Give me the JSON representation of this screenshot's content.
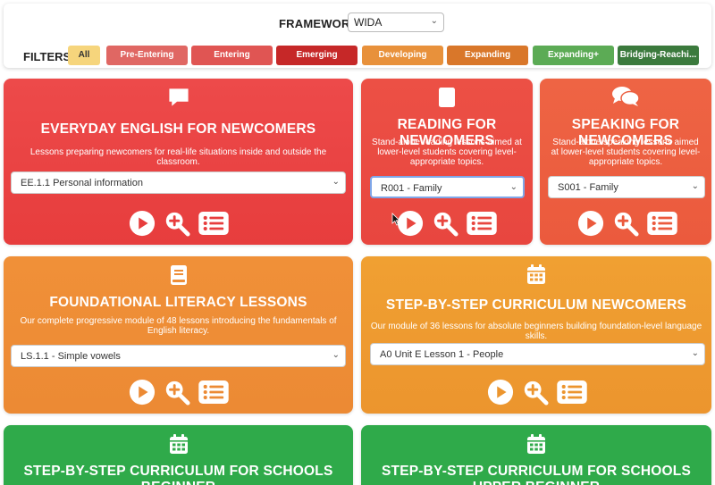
{
  "framework": {
    "label": "FRAMEWORK:",
    "selected": "WIDA"
  },
  "filters": {
    "label": "FILTERS:",
    "items": [
      {
        "label": "All",
        "color": "#f6d57c",
        "text_color": "#333333"
      },
      {
        "label": "Pre-Entering",
        "color": "#e06763",
        "text_color": "#ffffff"
      },
      {
        "label": "Entering",
        "color": "#e05553",
        "text_color": "#ffffff"
      },
      {
        "label": "Emerging",
        "color": "#c62828",
        "text_color": "#ffffff"
      },
      {
        "label": "Developing",
        "color": "#e8913b",
        "text_color": "#ffffff"
      },
      {
        "label": "Expanding",
        "color": "#d9772a",
        "text_color": "#ffffff"
      },
      {
        "label": "Expanding+",
        "color": "#5cab55",
        "text_color": "#ffffff"
      },
      {
        "label": "Bridging-Reachi...",
        "color": "#3b7a3d",
        "text_color": "#ffffff"
      }
    ]
  },
  "cards": {
    "everyday": {
      "title": "EVERYDAY ENGLISH FOR NEWCOMERS",
      "desc": "Lessons preparing newcomers for real-life situations inside and outside the classroom.",
      "selected": "EE.1.1 Personal information",
      "icon": "comment-icon"
    },
    "reading": {
      "title": "READING FOR NEWCOMERS",
      "desc": "Stand-alone reading lessons aimed at lower-level students covering level-appropriate topics.",
      "selected": "R001 - Family",
      "icon": "book-icon"
    },
    "speaking": {
      "title": "SPEAKING FOR NEWCOMERS",
      "desc": "Stand-alone speaking lessons aimed at lower-level students covering level-appropriate topics.",
      "selected": "S001 - Family",
      "icon": "comments-icon"
    },
    "literacy": {
      "title": "FOUNDATIONAL LITERACY LESSONS",
      "desc": "Our complete progressive module of 48 lessons introducing the fundamentals of English literacy.",
      "selected": "LS.1.1 - Simple vowels",
      "icon": "book-icon"
    },
    "curriculum": {
      "title": "STEP-BY-STEP CURRICULUM NEWCOMERS",
      "desc": "Our module of 36 lessons for absolute beginners building foundation-level language skills.",
      "selected": "A0 Unit E Lesson 1 - People",
      "icon": "calendar-icon"
    },
    "schools_beginner": {
      "title": "STEP-BY-STEP CURRICULUM FOR SCHOOLS BEGINNER",
      "icon": "calendar-icon"
    },
    "schools_upper": {
      "title": "STEP-BY-STEP CURRICULUM FOR SCHOOLS UPPER BEGINNER",
      "icon": "calendar-icon"
    }
  }
}
